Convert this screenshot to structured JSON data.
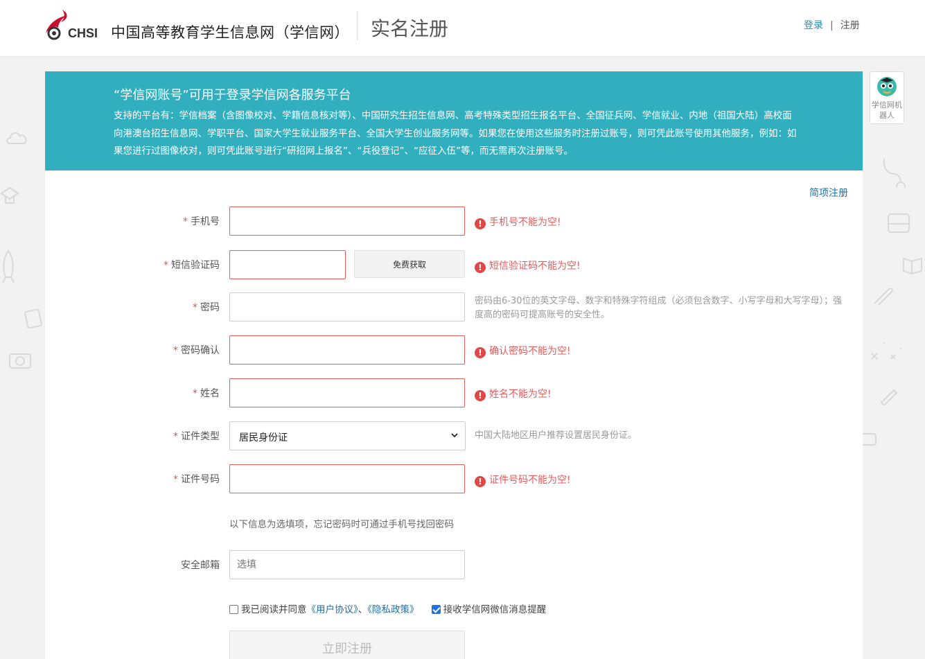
{
  "header": {
    "logo_text": "CHSI",
    "site_name": "中国高等教育学生信息网（学信网）",
    "page_title": "实名注册",
    "login_link": "登录",
    "separator": "|",
    "register_link": "注册"
  },
  "notice": {
    "title": "“学信网账号”可用于登录学信网各服务平台",
    "body": "支持的平台有：学信档案（含图像校对、学籍信息核对等）、中国研究生招生信息网、高考特殊类型招生报名平台、全国征兵网、学信就业、内地（祖国大陆）高校面向港澳台招生信息网、学职平台、国家大学生就业服务平台、全国大学生创业服务网等。如果您在使用这些服务时注册过账号，则可凭此账号使用其他服务，例如：如果您进行过图像校对，则可凭此账号进行“研招网上报名”、“兵役登记”、“应征入伍”等，而无需再次注册账号。"
  },
  "robot": {
    "label": "学信网机器人"
  },
  "form": {
    "simple_register": "简项注册",
    "required_mark": "*",
    "phone": {
      "label": "手机号",
      "value": "",
      "error": "手机号不能为空!"
    },
    "sms_code": {
      "label": "短信验证码",
      "value": "",
      "button": "免费获取",
      "error": "短信验证码不能为空!"
    },
    "password": {
      "label": "密码",
      "value": "",
      "hint": "密码由6-30位的英文字母、数字和特殊字符组成（必须包含数字、小写字母和大写字母）；强度高的密码可提高账号的安全性。"
    },
    "password_confirm": {
      "label": "密码确认",
      "value": "",
      "error": "确认密码不能为空!"
    },
    "name": {
      "label": "姓名",
      "value": "",
      "error": "姓名不能为空!"
    },
    "id_type": {
      "label": "证件类型",
      "selected": "居民身份证",
      "hint": "中国大陆地区用户推荐设置居民身份证。"
    },
    "id_number": {
      "label": "证件号码",
      "value": "",
      "error": "证件号码不能为空!"
    },
    "optional_note": "以下信息为选填项，忘记密码时可通过手机号找回密码",
    "email": {
      "label": "安全邮箱",
      "value": "",
      "placeholder": "选填"
    },
    "agreement": {
      "prefix": "我已阅读并同意",
      "user_agreement": "《用户协议》",
      "separator": "、",
      "privacy_policy": "《隐私政策》",
      "agreed": false,
      "wechat_label": "接收学信网微信消息提醒",
      "wechat_checked": true
    },
    "submit": "立即注册"
  },
  "colors": {
    "notice_bg": "#31afbf",
    "error": "#e25c5c",
    "link": "#1f6fa3"
  }
}
